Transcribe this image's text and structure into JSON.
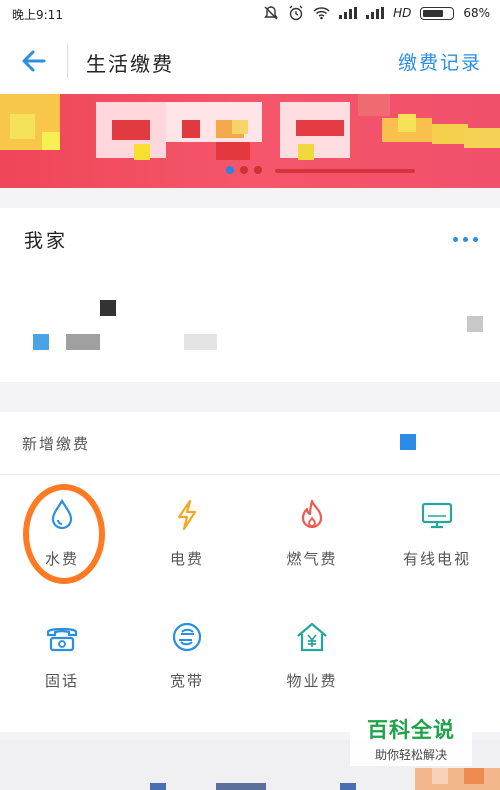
{
  "status_bar": {
    "time": "晚上9:11",
    "network": "HD",
    "battery": "68%"
  },
  "header": {
    "title": "生活缴费",
    "history_label": "缴费记录"
  },
  "my_home": {
    "title": "我家"
  },
  "add_payment": {
    "title": "新增缴费",
    "items": [
      {
        "label": "水费",
        "icon": "water-drop-icon"
      },
      {
        "label": "电费",
        "icon": "lightning-icon"
      },
      {
        "label": "燃气费",
        "icon": "flame-icon"
      },
      {
        "label": "有线电视",
        "icon": "tv-icon"
      },
      {
        "label": "固话",
        "icon": "telephone-icon"
      },
      {
        "label": "宽带",
        "icon": "broadband-icon"
      },
      {
        "label": "物业费",
        "icon": "property-house-icon"
      }
    ]
  },
  "colors": {
    "accent": "#2a8fe0",
    "highlight": "#ff7a22",
    "water": "#2a8fe0",
    "electric": "#f5a623",
    "gas": "#ef5a4f",
    "tv": "#26a69a",
    "phone": "#2a8fe0",
    "broadband": "#2a8fe0",
    "property": "#26a69a"
  },
  "watermark": {
    "main": "百科全说",
    "sub": "助你轻松解决"
  }
}
